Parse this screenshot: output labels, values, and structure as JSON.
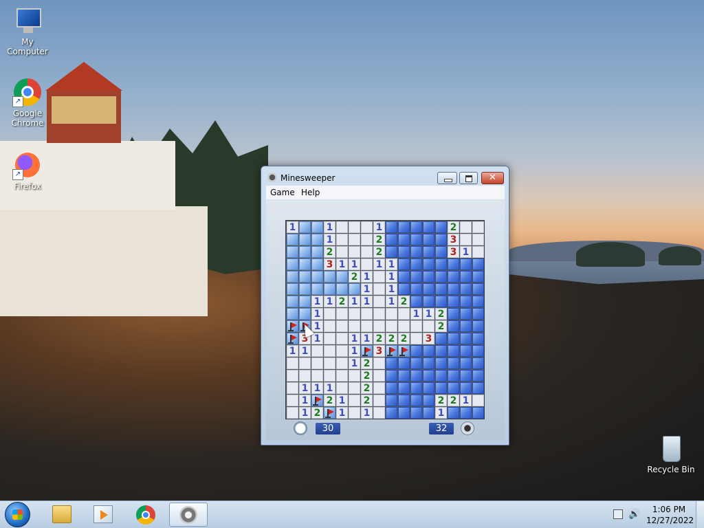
{
  "desktop": {
    "icons": [
      {
        "label": "My Computer",
        "icon": "computer-icon"
      },
      {
        "label": "Google Chrome",
        "icon": "chrome-icon"
      },
      {
        "label": "Firefox",
        "icon": "firefox-icon"
      },
      {
        "label": "Recycle Bin",
        "icon": "recycle-bin-icon"
      }
    ]
  },
  "window": {
    "title": "Minesweeper",
    "close_glyph": "✕",
    "menu": [
      "Game",
      "Help"
    ],
    "timer": "30",
    "mines_left": "32",
    "colors": {
      "covered": "#3f6fd9",
      "covered_lite": "#8cb6ea",
      "n1": "#3d4fbd",
      "n2": "#1e7a1e",
      "n3": "#b0211d"
    },
    "board": [
      "1LL1   1     2 ",
      "LLL1   2     3 ",
      "LLL2   2     31",
      "LLL311 11      ",
      "LLLLL21 1      ",
      "LLLLLL1 1      ",
      "LL11211 12     ",
      "LL1       112  ",
      "FF1         2  ",
      "F31  11222 3   ",
      "11   1F3FF     ",
      "     12        ",
      "      2        ",
      " 111  2        ",
      " 1F21 2     221",
      " 12F1 1     1  "
    ],
    "legend": "digits = revealed count, blank = revealed empty, L = unrevealed (light), F = flag, other unrevealed = dark"
  },
  "taskbar": {
    "apps": [
      "Windows Explorer",
      "Windows Media Player",
      "Google Chrome",
      "Minesweeper"
    ],
    "time": "1:06 PM",
    "date": "12/27/2022"
  }
}
